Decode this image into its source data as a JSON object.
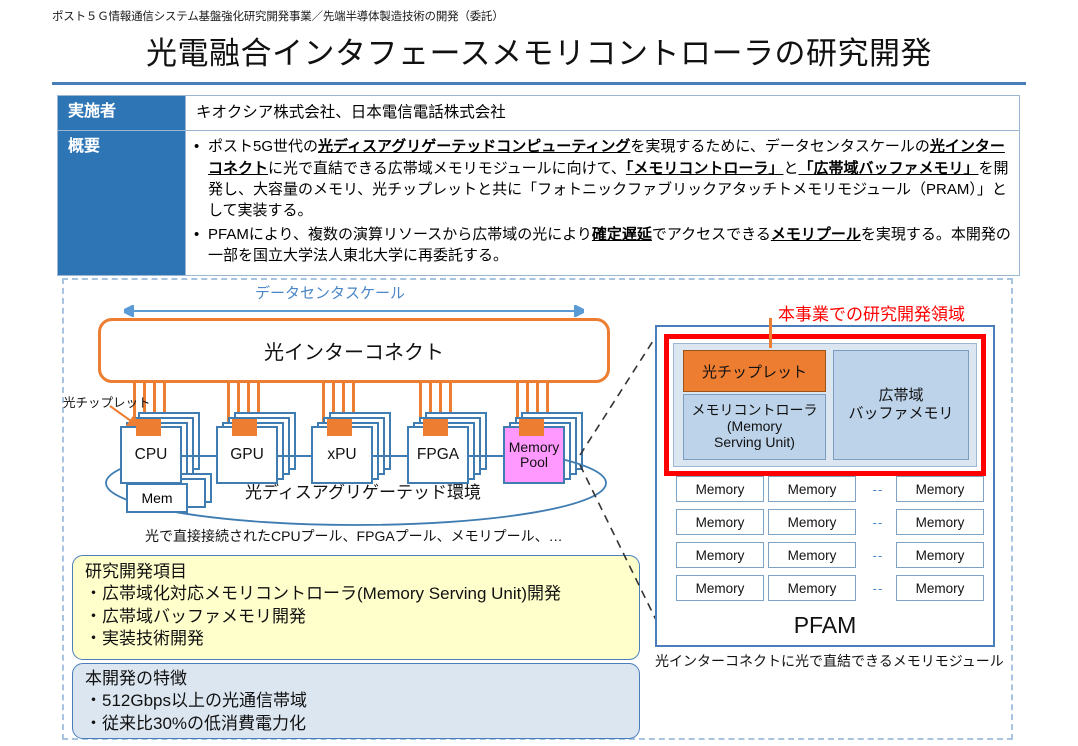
{
  "header": {
    "program_line": "ポスト５Ｇ情報通信システム基盤強化研究開発事業／先端半導体製造技術の開発（委託）",
    "title": "光電融合インタフェースメモリコントローラの研究開発"
  },
  "info_table": {
    "rows": [
      {
        "label": "実施者",
        "value": "キオクシア株式会社、日本電信電話株式会社"
      },
      {
        "label": "概要",
        "value": ""
      }
    ],
    "summary_bullets": [
      [
        {
          "t": "ポスト5G世代の",
          "b": false
        },
        {
          "t": "光ディスアグリゲーテッドコンピューティング",
          "b": true
        },
        {
          "t": "を実現するために、データセンタスケールの",
          "b": false
        },
        {
          "t": "光インターコネクト",
          "b": true
        },
        {
          "t": "に光で直結できる広帯域メモリモジュールに向けて、",
          "b": false
        },
        {
          "t": "「メモリコントローラ」",
          "b": true
        },
        {
          "t": "と",
          "b": false
        },
        {
          "t": "「広帯域バッファメモリ」",
          "b": true
        },
        {
          "t": "を開発し、大容量のメモリ、光チップレットと共に「フォトニックファブリックアタッチトメモリモジュール（PRAM）」として実装する。",
          "b": false
        }
      ],
      [
        {
          "t": "PFAMにより、複数の演算リソースから広帯域の光により",
          "b": false
        },
        {
          "t": "確定遅延",
          "b": true
        },
        {
          "t": "でアクセスできる",
          "b": false
        },
        {
          "t": "メモリプール",
          "b": true
        },
        {
          "t": "を実現する。本開発の一部を国立大学法人東北大学に再委託する。",
          "b": false
        }
      ]
    ],
    "bullet_mark": "•"
  },
  "left_diagram": {
    "dc_scale_label": "データセンタスケール",
    "optical_interconnect_label": "光インターコネクト",
    "chiplet_callout": "光チップレット",
    "nodes": [
      {
        "label": "CPU"
      },
      {
        "label": "GPU"
      },
      {
        "label": "xPU"
      },
      {
        "label": "FPGA"
      },
      {
        "label_line1": "Memory",
        "label_line2": "Pool"
      }
    ],
    "mem_box_label": "Mem",
    "disaggregated_label": "光ディスアグリゲーテッド環境",
    "pool_caption": "光で直接接続されたCPUプール、FPGAプール、メモリプール、…"
  },
  "rd_items_box": {
    "title": "研究開発項目",
    "lines": [
      "・広帯域化対応メモリコントローラ(Memory Serving Unit)開発",
      "・広帯域バッファメモリ開発",
      "・実装技術開発"
    ]
  },
  "features_box": {
    "title": "本開発の特徴",
    "lines": [
      "・512Gbps以上の光通信帯域",
      "・従来比30%の低消費電力化"
    ]
  },
  "pfam": {
    "region_label": "本事業での研究開発領域",
    "chiplet_label": "光チップレット",
    "mem_controller_lines": [
      "メモリコントローラ",
      "(Memory",
      "Serving Unit)"
    ],
    "buffer_lines": [
      "広帯域",
      "バッファメモリ"
    ],
    "memory_cell_label": "Memory",
    "gap_mark": "--",
    "rows": 4,
    "module_label": "PFAM",
    "caption": "光インターコネクトに光で直結できるメモリモジュール"
  },
  "colors": {
    "header_blue": "#2E75B6",
    "rule_blue": "#4A7EBB",
    "orange": "#ED7D31",
    "node_border_blue": "#3E7CB1",
    "magenta": "#FF99FF",
    "red": "#FF0000",
    "light_yellow": "#FFFFCC",
    "light_blue": "#DCE6F1",
    "mid_blue_fill": "#BDD3EA",
    "dash_frame": "#A8C4E0"
  }
}
